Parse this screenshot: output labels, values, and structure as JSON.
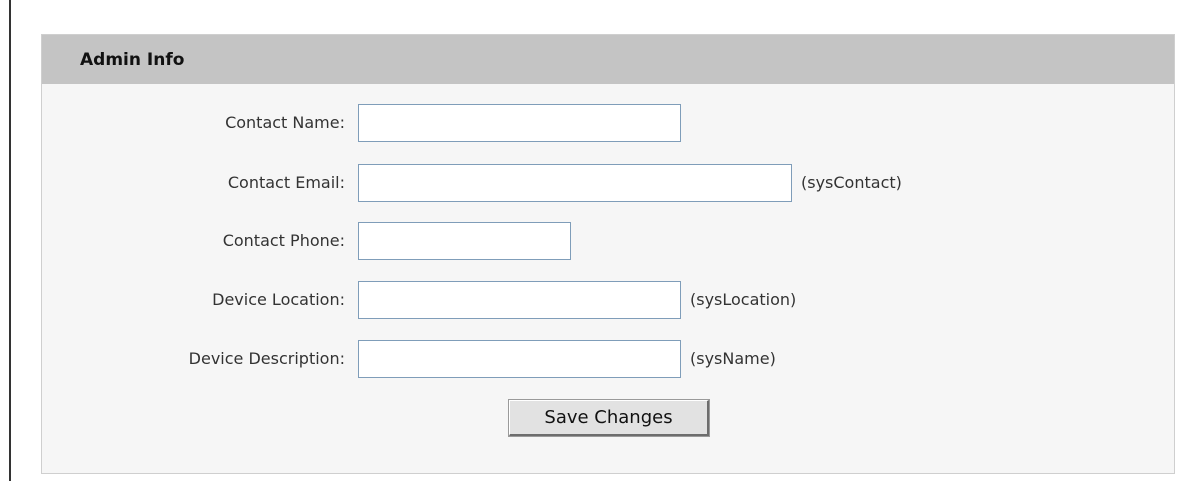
{
  "panel": {
    "title": "Admin Info"
  },
  "form": {
    "contact_name": {
      "label": "Contact Name:",
      "value": "",
      "hint": ""
    },
    "contact_email": {
      "label": "Contact Email:",
      "value": "",
      "hint": "(sysContact)"
    },
    "contact_phone": {
      "label": "Contact Phone:",
      "value": "",
      "hint": ""
    },
    "device_location": {
      "label": "Device Location:",
      "value": "",
      "hint": "(sysLocation)"
    },
    "device_description": {
      "label": "Device Description:",
      "value": "",
      "hint": "(sysName)"
    }
  },
  "actions": {
    "save_label": "Save Changes"
  },
  "colors": {
    "header_bg": "#c4c4c4",
    "panel_bg": "#f6f6f6",
    "field_border": "#7f9db9",
    "button_bg": "#e2e2e2"
  }
}
